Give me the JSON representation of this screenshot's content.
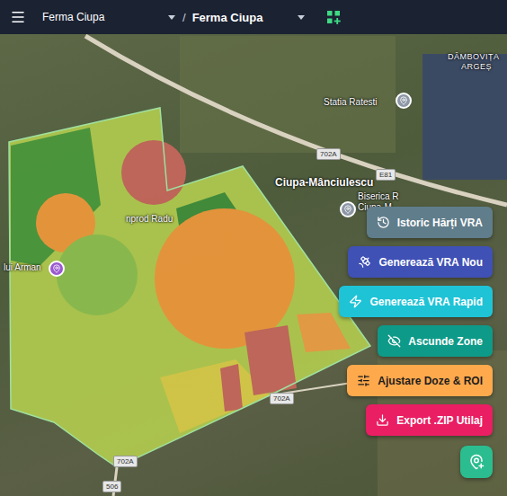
{
  "topbar": {
    "farm_select": "Ferma Ciupa",
    "separator": "/",
    "field_select": "Ferma Ciupa"
  },
  "map": {
    "labels": [
      {
        "text": "DÂMBOVIȚA",
        "kind": "region"
      },
      {
        "text": "ARGEȘ",
        "kind": "region"
      },
      {
        "text": "Statia Ratesti",
        "kind": "poi"
      },
      {
        "text": "E81",
        "kind": "shield"
      },
      {
        "text": "702A",
        "kind": "shield"
      },
      {
        "text": "Ciupa-Mânciulescu",
        "kind": "place"
      },
      {
        "text": "Biserica R",
        "kind": "poi"
      },
      {
        "text": "Ciupa-M",
        "kind": "poi"
      },
      {
        "text": "nprod Radu",
        "kind": "poi"
      },
      {
        "text": "lui Arman",
        "kind": "poi"
      },
      {
        "text": "702A",
        "kind": "shield"
      },
      {
        "text": "702A",
        "kind": "shield"
      },
      {
        "text": "506",
        "kind": "shield"
      }
    ]
  },
  "zones": [
    {
      "color": "#b3cd4f"
    },
    {
      "color": "#4a9a3c"
    },
    {
      "color": "#3f8f3a"
    },
    {
      "color": "#dccf48"
    },
    {
      "color": "#f39a3b"
    },
    {
      "color": "#c9675c"
    },
    {
      "color": "#8fc24f"
    },
    {
      "color": "#f39a3b"
    },
    {
      "color": "#c9675c"
    },
    {
      "color": "#f0a044"
    },
    {
      "color": "#c9675c"
    }
  ],
  "actions": [
    {
      "label": "Istoric Hărți VRA",
      "color": "#607d8b"
    },
    {
      "label": "Generează VRA Nou",
      "color": "#3f51b5"
    },
    {
      "label": "Generează VRA Rapid",
      "color": "#1fc3d6"
    },
    {
      "label": "Ascunde Zone",
      "color": "#0e9a88"
    },
    {
      "label": "Ajustare Doze & ROI",
      "color": "#ffa94d"
    },
    {
      "label": "Export .ZIP Utilaj",
      "color": "#e91e63"
    }
  ]
}
